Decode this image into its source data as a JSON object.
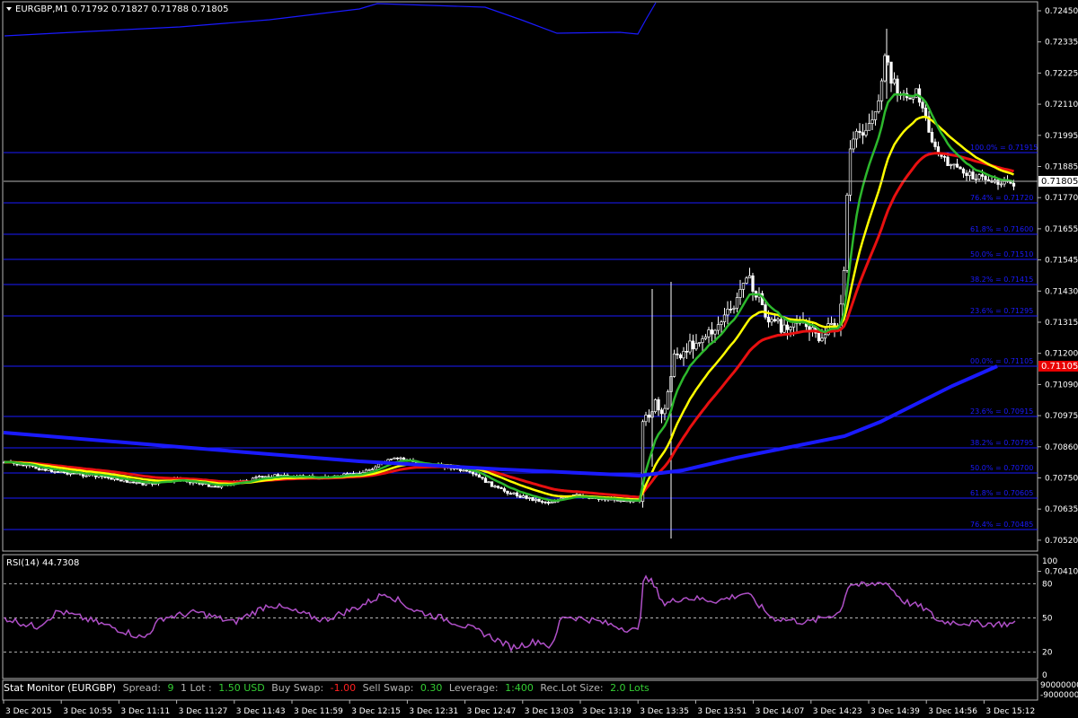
{
  "main_header": {
    "menu_arrow": "triangle-down-icon",
    "text": "EURGBP,M1  0.71792 0.71827 0.71788 0.71805"
  },
  "price_scale": {
    "labels": [
      "0.72450",
      "0.72335",
      "0.72225",
      "0.72110",
      "0.71995",
      "0.71885",
      "0.71770",
      "0.71655",
      "0.71545",
      "0.71430",
      "0.71315",
      "0.71200",
      "0.71090",
      "0.70975",
      "0.70860",
      "0.70750",
      "0.70635",
      "0.70520",
      "0.70410"
    ],
    "current_price": "0.71805",
    "marked_price": "0.71105"
  },
  "fib_upper": [
    {
      "label": "100.0% = 0.71915"
    },
    {
      "label": "76.4% = 0.71720"
    },
    {
      "label": "61.8% = 0.71600"
    },
    {
      "label": "50.0% = 0.71510"
    },
    {
      "label": "38.2% = 0.71415"
    },
    {
      "label": "23.6% = 0.71295"
    },
    {
      "label": "00.0% = 0.71105"
    }
  ],
  "fib_lower": [
    {
      "label": "23.6% = 0.70915"
    },
    {
      "label": "38.2% = 0.70795"
    },
    {
      "label": "50.0% = 0.70700"
    },
    {
      "label": "61.8% = 0.70605"
    },
    {
      "label": "76.4% = 0.70485"
    }
  ],
  "rsi_panel": {
    "title": "RSI(14) 44.7308",
    "levels": [
      "100",
      "80",
      "50",
      "20",
      "0"
    ]
  },
  "stat_monitor": {
    "title": "Stat Monitor (EURGBP)",
    "spread_label": "Spread:",
    "spread_value": "9",
    "lot_label": "1 Lot :",
    "lot_value": "1.50 USD",
    "buy_swap_label": "Buy Swap:",
    "buy_swap_value": "-1.00",
    "sell_swap_label": "Sell Swap:",
    "sell_swap_value": "0.30",
    "leverage_label": "Leverage:",
    "leverage_value": "1:400",
    "lot_size_label": "Rec.Lot Size:",
    "lot_size_value": "2.0 Lots",
    "scale_top": "90000000",
    "scale_bottom": "-90000000"
  },
  "time_axis": {
    "labels": [
      "3 Dec 2015",
      "3 Dec 10:55",
      "3 Dec 11:11",
      "3 Dec 11:27",
      "3 Dec 11:43",
      "3 Dec 11:59",
      "3 Dec 12:15",
      "3 Dec 12:31",
      "3 Dec 12:47",
      "3 Dec 13:03",
      "3 Dec 13:19",
      "3 Dec 13:35",
      "3 Dec 13:51",
      "3 Dec 14:07",
      "3 Dec 14:23",
      "3 Dec 14:39",
      "3 Dec 14:56",
      "3 Dec 15:12"
    ]
  },
  "colors": {
    "fib": "#1a1aff",
    "ma_blue": "#1a1aff",
    "ma_red": "#e81010",
    "ma_yellow": "#ffff00",
    "ma_green": "#2db82d",
    "rsi": "#b050c8",
    "candle": "#ffffff",
    "current_price_bg": "#ffffff",
    "marked_price_bg": "#e80000"
  }
}
